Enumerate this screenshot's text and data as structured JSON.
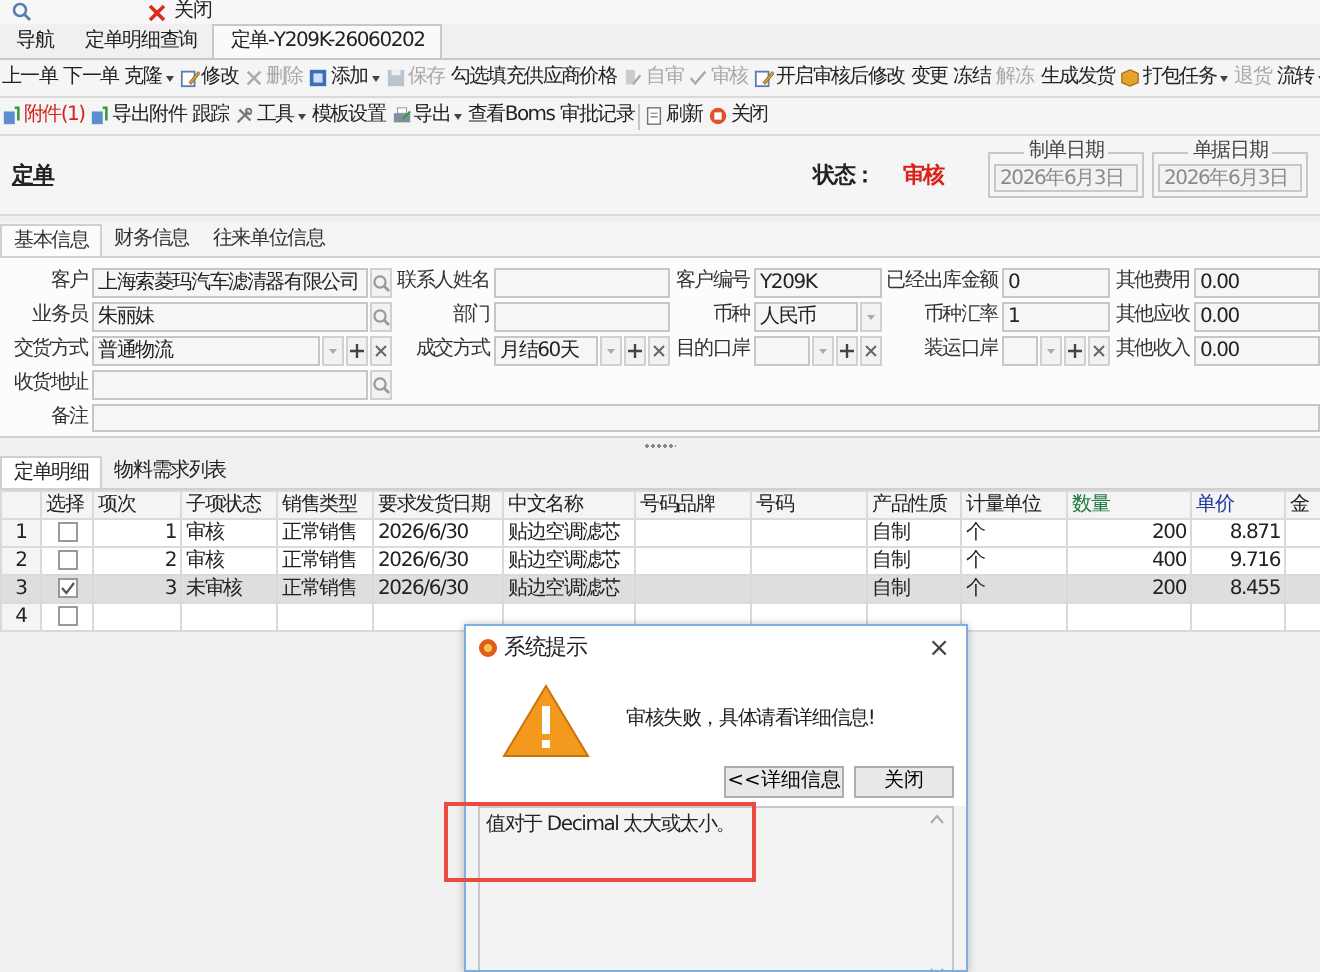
{
  "top_bar": {
    "close_label": "关闭"
  },
  "nav_tabs": [
    {
      "label": "导航",
      "selected": false
    },
    {
      "label": "定单明细查询",
      "selected": false
    },
    {
      "label": "定单-Y209K-26060202",
      "selected": true
    }
  ],
  "toolbar_1": [
    [
      {
        "label": "上一单",
        "dropdown": false,
        "disabled": false
      },
      {
        "label": "下一单",
        "dropdown": false,
        "disabled": false
      },
      {
        "label": "克隆",
        "dropdown": true,
        "disabled": false
      },
      {
        "label": "修改",
        "dropdown": false,
        "disabled": false
      },
      {
        "label": "删除",
        "dropdown": false,
        "disabled": true
      },
      {
        "label": "添加",
        "dropdown": true,
        "disabled": false
      },
      {
        "label": "保存",
        "dropdown": false,
        "disabled": true
      },
      {
        "label": "勾选填充供应商价格",
        "dropdown": false,
        "disabled": false
      }
    ],
    [
      {
        "label": "自审",
        "dropdown": false,
        "disabled": true
      },
      {
        "label": "审核",
        "dropdown": false,
        "disabled": true
      },
      {
        "label": "开启审核后修改",
        "dropdown": false,
        "disabled": false
      },
      {
        "label": "变更",
        "dropdown": false,
        "disabled": false
      },
      {
        "label": "冻结",
        "dropdown": false,
        "disabled": false
      },
      {
        "label": "解冻",
        "dropdown": false,
        "disabled": true
      }
    ],
    [
      {
        "label": "生成发货",
        "dropdown": false,
        "disabled": false
      },
      {
        "label": "打包任务",
        "dropdown": true,
        "disabled": false
      },
      {
        "label": "退货",
        "dropdown": false,
        "disabled": true
      },
      {
        "label": "流转",
        "dropdown": true,
        "disabled": false
      }
    ]
  ],
  "toolbar_2": [
    [
      {
        "label": "附件(1)",
        "dropdown": false,
        "highlighted": true
      },
      {
        "label": "导出附件",
        "dropdown": false,
        "highlighted": false
      },
      {
        "label": "跟踪",
        "dropdown": false,
        "highlighted": false
      },
      {
        "label": "工具",
        "dropdown": true,
        "highlighted": false
      },
      {
        "label": "模板设置",
        "dropdown": false,
        "highlighted": false
      },
      {
        "label": "导出",
        "dropdown": true,
        "highlighted": false
      },
      {
        "label": "查看Boms",
        "dropdown": false,
        "highlighted": false
      },
      {
        "label": "审批记录",
        "dropdown": false,
        "highlighted": false
      }
    ],
    [
      {
        "label": "刷新",
        "dropdown": false,
        "highlighted": false
      },
      {
        "label": "关闭",
        "dropdown": false,
        "highlighted": false
      }
    ]
  ],
  "header": {
    "title": "定单",
    "status_label": "状态：",
    "status": "审核",
    "dates": [
      {
        "legend": "制单日期",
        "value": "2026年6月3日",
        "disabled": true
      },
      {
        "legend": "单据日期",
        "value": "2026年6月3日",
        "disabled": true
      }
    ]
  },
  "form_tabs": [
    {
      "label": "基本信息",
      "selected": true
    },
    {
      "label": "财务信息",
      "selected": false
    },
    {
      "label": "往来单位信息",
      "selected": false
    }
  ],
  "form_rows": [
    [
      {
        "label": "客户",
        "value": "上海索菱玛汽车滤清器有限公司",
        "kind": "lookup"
      },
      {
        "label": "联系人姓名",
        "kind": "text"
      },
      {
        "label": "客户编号",
        "value": "Y209K",
        "kind": "text"
      },
      {
        "label": "已经出库金额",
        "value": "0",
        "kind": "text"
      },
      {
        "label": "其他费用",
        "value": "0.00",
        "kind": "text"
      }
    ],
    [
      {
        "label": "业务员",
        "value": "朱丽妹",
        "kind": "lookup"
      },
      {
        "label": "部门",
        "kind": "text"
      },
      {
        "label": "币种",
        "value": "人民币",
        "kind": "select"
      },
      {
        "label": "币种汇率",
        "value": "1",
        "kind": "text"
      },
      {
        "label": "其他应收",
        "value": "0.00",
        "kind": "text"
      }
    ],
    [
      {
        "label": "交货方式",
        "value": "普通物流",
        "kind": "select_add"
      },
      {
        "label": "成交方式",
        "value": "月结60天",
        "kind": "select_add"
      },
      {
        "label": "目的口岸",
        "kind": "select_add"
      },
      {
        "label": "装运口岸",
        "kind": "select_add"
      },
      {
        "label": "其他收入",
        "value": "0.00",
        "kind": "text"
      }
    ],
    [
      {
        "label": "收货地址",
        "kind": "lookup"
      }
    ],
    [
      {
        "label": "备注",
        "kind": "memo"
      }
    ]
  ],
  "detail_tabs": [
    {
      "label": "定单明细",
      "selected": true
    },
    {
      "label": "物料需求列表",
      "selected": false
    }
  ],
  "table": {
    "columns": [
      {
        "label": "选择",
        "color": "#222222"
      },
      {
        "label": "项次",
        "color": "#222222"
      },
      {
        "label": "子项状态",
        "color": "#222222"
      },
      {
        "label": "销售类型",
        "color": "#222222"
      },
      {
        "label": "要求发货日期",
        "color": "#222222"
      },
      {
        "label": "中文名称",
        "color": "#222222"
      },
      {
        "label": "号码品牌",
        "color": "#222222"
      },
      {
        "label": "号码",
        "color": "#222222"
      },
      {
        "label": "产品性质",
        "color": "#222222"
      },
      {
        "label": "计量单位",
        "color": "#222222"
      },
      {
        "label": "数量",
        "color": "#1e7a3e"
      },
      {
        "label": "单价",
        "color": "#2233a0"
      },
      {
        "label": "金",
        "color": "#222222"
      }
    ],
    "rows": [
      {
        "row_number": "1",
        "selected": false,
        "checked": false,
        "cells": [
          "1",
          "审核",
          "正常销售",
          "2026/6/30",
          "贴边空调滤芯",
          null,
          null,
          "自制",
          "个",
          "200",
          "8.871"
        ]
      },
      {
        "row_number": "2",
        "selected": false,
        "checked": false,
        "cells": [
          "2",
          "审核",
          "正常销售",
          "2026/6/30",
          "贴边空调滤芯",
          null,
          null,
          "自制",
          "个",
          "400",
          "9.716"
        ]
      },
      {
        "row_number": "3",
        "selected": true,
        "checked": true,
        "cells": [
          "3",
          "未审核",
          "正常销售",
          "2026/6/30",
          "贴边空调滤芯",
          null,
          null,
          "自制",
          "个",
          "200",
          "8.455"
        ]
      },
      {
        "row_number": "4",
        "selected": false,
        "checked": false
      }
    ]
  },
  "dialog": {
    "title": "系统提示",
    "close": "×",
    "message": "审核失败，具体请看详细信息!",
    "buttons": [
      "<<详细信息",
      "关闭"
    ],
    "details": "值对于 Decimal 太大或太小。"
  }
}
